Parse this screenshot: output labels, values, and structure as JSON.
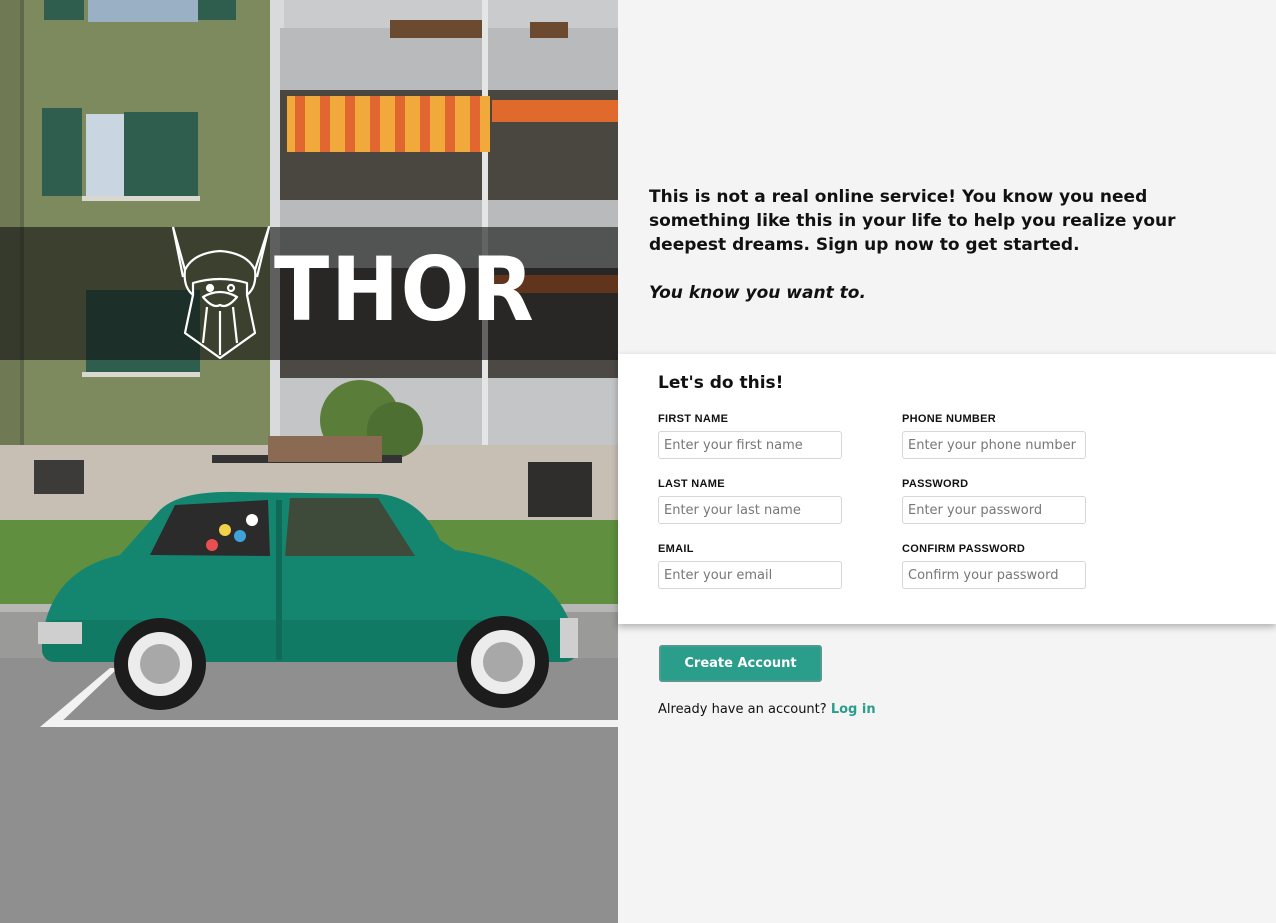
{
  "hero": {
    "brand": "THOR"
  },
  "intro": {
    "text": "This is not a real online service! You know you need something like this in your life to help you realize your deepest dreams. Sign up now to get started.",
    "tagline": "You know you want to."
  },
  "form": {
    "title": "Let's do this!",
    "fields": {
      "first_name": {
        "label": "FIRST NAME",
        "placeholder": "Enter your first name"
      },
      "last_name": {
        "label": "LAST NAME",
        "placeholder": "Enter your last name"
      },
      "email": {
        "label": "EMAIL",
        "placeholder": "Enter your email"
      },
      "phone": {
        "label": "PHONE NUMBER",
        "placeholder": "Enter your phone number"
      },
      "password": {
        "label": "PASSWORD",
        "placeholder": "Enter your password"
      },
      "confirm_password": {
        "label": "CONFIRM PASSWORD",
        "placeholder": "Confirm your password"
      }
    }
  },
  "actions": {
    "create_label": "Create Account",
    "login_prompt": "Already have an account?",
    "login_link": "Log in"
  },
  "colors": {
    "accent": "#2a9d8b",
    "panel_bg": "#f4f4f4",
    "card_bg": "#ffffff"
  },
  "icons": {
    "logo": "viking-head-icon"
  }
}
